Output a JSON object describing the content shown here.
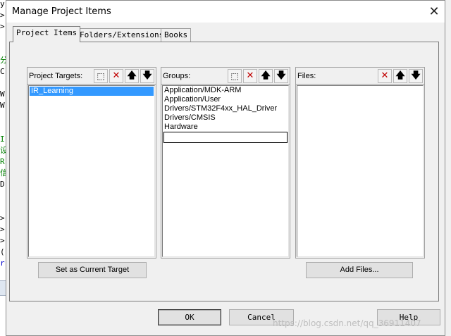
{
  "background_editor": {
    "glyphs": [
      "y",
      ">",
      ">",
      "分",
      "C",
      "W",
      "W",
      "I",
      "设",
      "R",
      "信",
      "D",
      ">",
      ">",
      ">",
      "(",
      "r"
    ]
  },
  "dialog": {
    "title": "Manage Project Items",
    "close_glyph": "✕",
    "tabs": [
      {
        "label": "Project Items",
        "active": true
      },
      {
        "label": "Folders/Extensions",
        "active": false
      },
      {
        "label": "Books",
        "active": false
      }
    ],
    "project_targets": {
      "label": "Project Targets:",
      "items": [
        "IR_Learning"
      ],
      "selected": "IR_Learning"
    },
    "groups": {
      "label": "Groups:",
      "items": [
        "Application/MDK-ARM",
        "Application/User",
        "Drivers/STM32F4xx_HAL_Driver",
        "Drivers/CMSIS",
        "Hardware"
      ],
      "editing_value": ""
    },
    "files": {
      "label": "Files:",
      "items": []
    },
    "toolbar_glyphs": {
      "new": "⬚",
      "delete": "✕",
      "up": "🡅",
      "down": "🡇"
    },
    "buttons": {
      "set_current_target": "Set as Current Target",
      "add_files": "Add Files...",
      "ok": "OK",
      "cancel": "Cancel",
      "help": "Help"
    },
    "watermark": "https://blog.csdn.net/qq_36911407"
  }
}
